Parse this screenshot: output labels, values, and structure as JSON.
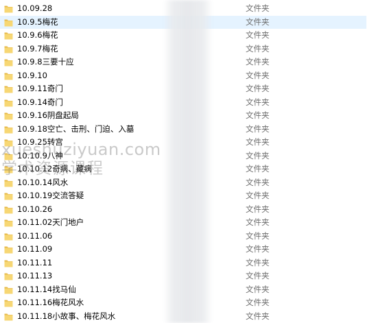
{
  "files": [
    {
      "name": "10.09.28",
      "type": "文件夹"
    },
    {
      "name": "10.9.5梅花",
      "type": "文件夹",
      "selected": true
    },
    {
      "name": "10.9.6梅花",
      "type": "文件夹"
    },
    {
      "name": "10.9.7梅花",
      "type": "文件夹"
    },
    {
      "name": "10.9.8三要十应",
      "type": "文件夹"
    },
    {
      "name": "10.9.10",
      "type": "文件夹"
    },
    {
      "name": "10.9.11奇门",
      "type": "文件夹"
    },
    {
      "name": "10.9.14奇门",
      "type": "文件夹"
    },
    {
      "name": "10.9.16阴盘起局",
      "type": "文件夹"
    },
    {
      "name": "10.9.18空亡、击刑、门迫、入墓",
      "type": "文件夹"
    },
    {
      "name": "10.9.25转宫",
      "type": "文件夹"
    },
    {
      "name": "10.10.9八神",
      "type": "文件夹"
    },
    {
      "name": "10.10.12奇病、藏病",
      "type": "文件夹"
    },
    {
      "name": "10.10.14风水",
      "type": "文件夹"
    },
    {
      "name": "10.10.19交流答疑",
      "type": "文件夹"
    },
    {
      "name": "10.10.26",
      "type": "文件夹"
    },
    {
      "name": "10.11.02天门地户",
      "type": "文件夹"
    },
    {
      "name": "10.11.06",
      "type": "文件夹"
    },
    {
      "name": "10.11.09",
      "type": "文件夹"
    },
    {
      "name": "10.11.11",
      "type": "文件夹"
    },
    {
      "name": "10.11.13",
      "type": "文件夹"
    },
    {
      "name": "10.11.14找马仙",
      "type": "文件夹"
    },
    {
      "name": "10.11.16梅花风水",
      "type": "文件夹"
    },
    {
      "name": "10.11.18小故事、梅花风水",
      "type": "文件夹"
    }
  ],
  "watermark": {
    "line1": "xueshuziyuan.com",
    "line2": "学术资源课程"
  },
  "colors": {
    "folder": "#f7d774",
    "folder_dark": "#e6b84a",
    "selected_row": "#e5f3ff",
    "type_text": "#6d6d6d"
  }
}
